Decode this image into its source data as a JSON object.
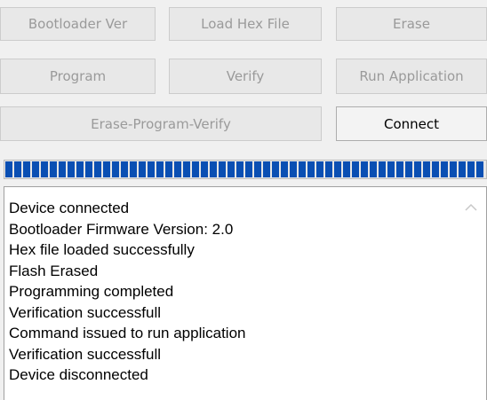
{
  "buttons": {
    "bootloader_ver": "Bootloader Ver",
    "load_hex_file": "Load Hex File",
    "erase": "Erase",
    "program": "Program",
    "verify": "Verify",
    "run_application": "Run Application",
    "erase_program_verify": "Erase-Program-Verify",
    "connect": "Connect"
  },
  "progress": {
    "value": 1.0,
    "color": "#0a4fb3"
  },
  "log": {
    "lines": [
      "Device connected",
      "Bootloader Firmware Version: 2.0",
      "Hex file loaded successfully",
      "Flash Erased",
      "Programming completed",
      "Verification successfull",
      "Command issued to run application",
      "Verification successfull",
      "Device disconnected"
    ]
  },
  "icons": {
    "scroll_up": "chevron-up-icon"
  }
}
